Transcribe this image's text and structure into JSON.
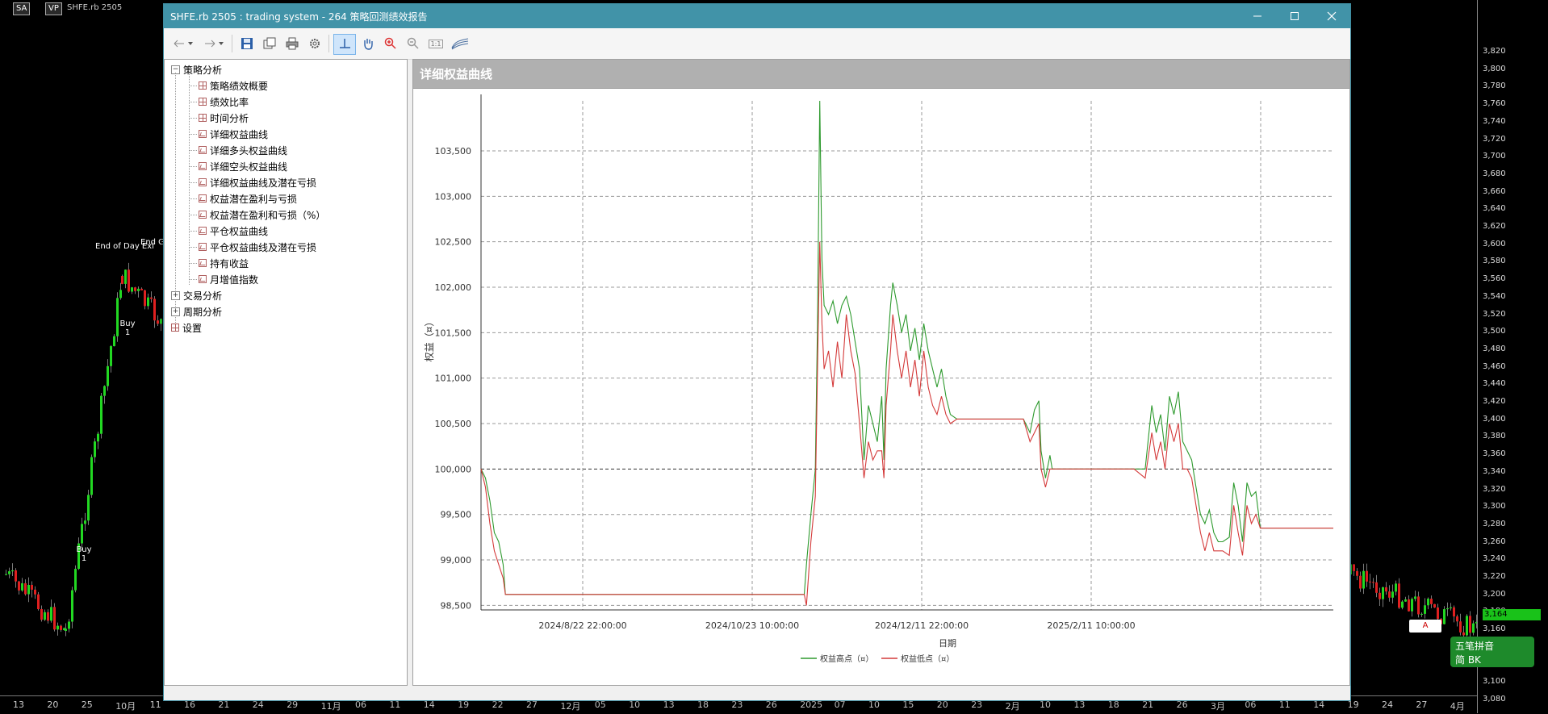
{
  "background_app": {
    "tags": [
      "SA",
      "VP",
      "SHFE.rb 2505"
    ],
    "price_ticks": [
      "3,820",
      "3,800",
      "3,780",
      "3,760",
      "3,740",
      "3,720",
      "3,700",
      "3,680",
      "3,660",
      "3,640",
      "3,620",
      "3,600",
      "3,580",
      "3,560",
      "3,540",
      "3,520",
      "3,500",
      "3,480",
      "3,460",
      "3,440",
      "3,420",
      "3,400",
      "3,380",
      "3,360",
      "3,340",
      "3,320",
      "3,300",
      "3,280",
      "3,260",
      "3,240",
      "3,220",
      "3,200",
      "3,180",
      "3,160",
      "3,140",
      "3,120",
      "3,100",
      "3,080"
    ],
    "current_price": "3,164",
    "date_ticks": [
      "13",
      "20",
      "25",
      "10月",
      "11",
      "16",
      "21",
      "24",
      "29",
      "11月",
      "06",
      "11",
      "14",
      "19",
      "22",
      "27",
      "12月",
      "05",
      "10",
      "13",
      "18",
      "23",
      "26",
      "2025",
      "07",
      "10",
      "15",
      "20",
      "23",
      "2月",
      "10",
      "13",
      "18",
      "21",
      "26",
      "3月",
      "06",
      "11",
      "14",
      "19",
      "24",
      "27",
      "4月"
    ],
    "annotations": [
      "End of Day Exi",
      "End G",
      "Buy 1",
      "Buy 1"
    ]
  },
  "window": {
    "title": "SHFE.rb 2505 : trading system - 264 策略回测绩效报告",
    "colors": {
      "titlebar": "#4193a8",
      "series_high": "#2e9a2e",
      "series_low": "#d43a3a"
    }
  },
  "toolbar": {
    "icons": [
      "back-icon",
      "back-dropdown-icon",
      "forward-icon",
      "forward-dropdown-icon",
      "save-icon",
      "export-icon",
      "print-icon",
      "settings-icon",
      "crosshair-icon",
      "pan-hand-icon",
      "zoom-in-icon",
      "zoom-out-icon",
      "reset-zoom-icon",
      "chart-style-icon"
    ],
    "reset_zoom_label": "1:1"
  },
  "tree": {
    "root": "策略分析",
    "children": [
      "策略绩效概要",
      "绩效比率",
      "时间分析",
      "详细权益曲线",
      "详细多头权益曲线",
      "详细空头权益曲线",
      "详细权益曲线及潜在亏损",
      "权益潜在盈利与亏损",
      "权益潜在盈利和亏损（%）",
      "平仓权益曲线",
      "平仓权益曲线及潜在亏损",
      "持有收益",
      "月增值指数"
    ],
    "others": [
      "交易分析",
      "周期分析",
      "设置"
    ]
  },
  "panel": {
    "title": "详细权益曲线"
  },
  "chart_data": {
    "type": "line",
    "title": "",
    "xlabel": "日期",
    "ylabel": "权益（¤）",
    "x_tick_labels": [
      "2024/8/22 22:00:00",
      "2024/10/23 10:00:00",
      "2024/12/11 22:00:00",
      "2025/2/11 10:00:00"
    ],
    "y_ticks": [
      98500,
      99000,
      99500,
      100000,
      100500,
      101000,
      101500,
      102000,
      102500,
      103000,
      103500
    ],
    "ylim": [
      98450,
      104050
    ],
    "grid": true,
    "legend_position": "bottom",
    "series": [
      {
        "name": "权益高点（¤）",
        "color": "#2e9a2e",
        "values": [
          [
            0,
            100000
          ],
          [
            2,
            99900
          ],
          [
            4,
            99650
          ],
          [
            6,
            99300
          ],
          [
            8,
            99200
          ],
          [
            10,
            98950
          ],
          [
            11,
            98620
          ],
          [
            20,
            98620
          ],
          [
            40,
            98620
          ],
          [
            80,
            98620
          ],
          [
            120,
            98620
          ],
          [
            140,
            98620
          ],
          [
            146,
            98620
          ],
          [
            147,
            98950
          ],
          [
            149,
            99500
          ],
          [
            151,
            100000
          ],
          [
            152,
            101600
          ],
          [
            153,
            104050
          ],
          [
            154,
            102300
          ],
          [
            155,
            101800
          ],
          [
            157,
            101700
          ],
          [
            159,
            101850
          ],
          [
            161,
            101600
          ],
          [
            163,
            101800
          ],
          [
            165,
            101900
          ],
          [
            167,
            101700
          ],
          [
            169,
            101400
          ],
          [
            171,
            101100
          ],
          [
            173,
            100100
          ],
          [
            175,
            100700
          ],
          [
            177,
            100500
          ],
          [
            179,
            100300
          ],
          [
            181,
            100800
          ],
          [
            182,
            100100
          ],
          [
            183,
            101100
          ],
          [
            185,
            101800
          ],
          [
            186,
            102050
          ],
          [
            188,
            101800
          ],
          [
            190,
            101500
          ],
          [
            192,
            101700
          ],
          [
            194,
            101300
          ],
          [
            196,
            101550
          ],
          [
            198,
            101200
          ],
          [
            200,
            101600
          ],
          [
            202,
            101300
          ],
          [
            204,
            101100
          ],
          [
            206,
            100900
          ],
          [
            208,
            101100
          ],
          [
            210,
            100800
          ],
          [
            212,
            100600
          ],
          [
            215,
            100550
          ],
          [
            230,
            100550
          ],
          [
            245,
            100550
          ],
          [
            248,
            100400
          ],
          [
            250,
            100650
          ],
          [
            252,
            100750
          ],
          [
            253,
            100200
          ],
          [
            255,
            99900
          ],
          [
            257,
            100150
          ],
          [
            258,
            100000
          ],
          [
            270,
            100000
          ],
          [
            295,
            100000
          ],
          [
            300,
            100000
          ],
          [
            303,
            100700
          ],
          [
            305,
            100400
          ],
          [
            307,
            100600
          ],
          [
            309,
            100200
          ],
          [
            311,
            100800
          ],
          [
            313,
            100600
          ],
          [
            315,
            100850
          ],
          [
            317,
            100300
          ],
          [
            319,
            100200
          ],
          [
            321,
            100100
          ],
          [
            323,
            99800
          ],
          [
            325,
            99500
          ],
          [
            327,
            99400
          ],
          [
            329,
            99550
          ],
          [
            331,
            99300
          ],
          [
            333,
            99200
          ],
          [
            335,
            99200
          ],
          [
            338,
            99250
          ],
          [
            340,
            99850
          ],
          [
            342,
            99600
          ],
          [
            344,
            99200
          ],
          [
            346,
            99850
          ],
          [
            348,
            99700
          ],
          [
            350,
            99750
          ],
          [
            352,
            99350
          ],
          [
            360,
            99350
          ],
          [
            385,
            99350
          ]
        ]
      },
      {
        "name": "权益低点（¤）",
        "color": "#d43a3a",
        "values": [
          [
            0,
            100000
          ],
          [
            2,
            99800
          ],
          [
            4,
            99400
          ],
          [
            6,
            99100
          ],
          [
            8,
            98950
          ],
          [
            10,
            98800
          ],
          [
            11,
            98620
          ],
          [
            20,
            98620
          ],
          [
            40,
            98620
          ],
          [
            80,
            98620
          ],
          [
            120,
            98620
          ],
          [
            140,
            98620
          ],
          [
            146,
            98620
          ],
          [
            147,
            98500
          ],
          [
            149,
            99200
          ],
          [
            151,
            99700
          ],
          [
            152,
            101100
          ],
          [
            153,
            102500
          ],
          [
            154,
            101600
          ],
          [
            155,
            101100
          ],
          [
            157,
            101300
          ],
          [
            159,
            100900
          ],
          [
            161,
            101400
          ],
          [
            163,
            101000
          ],
          [
            165,
            101700
          ],
          [
            167,
            101300
          ],
          [
            169,
            101050
          ],
          [
            171,
            100500
          ],
          [
            173,
            99900
          ],
          [
            175,
            100300
          ],
          [
            177,
            100100
          ],
          [
            179,
            100200
          ],
          [
            181,
            100200
          ],
          [
            182,
            99900
          ],
          [
            183,
            100700
          ],
          [
            185,
            101300
          ],
          [
            186,
            101700
          ],
          [
            188,
            101300
          ],
          [
            190,
            101000
          ],
          [
            192,
            101300
          ],
          [
            194,
            100900
          ],
          [
            196,
            101200
          ],
          [
            198,
            100800
          ],
          [
            200,
            101300
          ],
          [
            202,
            100900
          ],
          [
            204,
            100700
          ],
          [
            206,
            100600
          ],
          [
            208,
            100800
          ],
          [
            210,
            100600
          ],
          [
            212,
            100500
          ],
          [
            215,
            100550
          ],
          [
            230,
            100550
          ],
          [
            245,
            100550
          ],
          [
            248,
            100300
          ],
          [
            250,
            100400
          ],
          [
            252,
            100500
          ],
          [
            253,
            100000
          ],
          [
            255,
            99800
          ],
          [
            257,
            100000
          ],
          [
            258,
            100000
          ],
          [
            270,
            100000
          ],
          [
            295,
            100000
          ],
          [
            300,
            99900
          ],
          [
            303,
            100400
          ],
          [
            305,
            100100
          ],
          [
            307,
            100300
          ],
          [
            309,
            100000
          ],
          [
            311,
            100500
          ],
          [
            313,
            100300
          ],
          [
            315,
            100500
          ],
          [
            317,
            100000
          ],
          [
            319,
            100000
          ],
          [
            321,
            99900
          ],
          [
            323,
            99600
          ],
          [
            325,
            99300
          ],
          [
            327,
            99100
          ],
          [
            329,
            99300
          ],
          [
            331,
            99100
          ],
          [
            333,
            99100
          ],
          [
            335,
            99100
          ],
          [
            338,
            99050
          ],
          [
            340,
            99600
          ],
          [
            342,
            99300
          ],
          [
            344,
            99050
          ],
          [
            346,
            99600
          ],
          [
            348,
            99400
          ],
          [
            350,
            99500
          ],
          [
            352,
            99350
          ],
          [
            360,
            99350
          ],
          [
            385,
            99350
          ]
        ]
      }
    ]
  },
  "ime": {
    "line1": "五笔拼音",
    "line2": "简 BK",
    "tray": "A"
  }
}
